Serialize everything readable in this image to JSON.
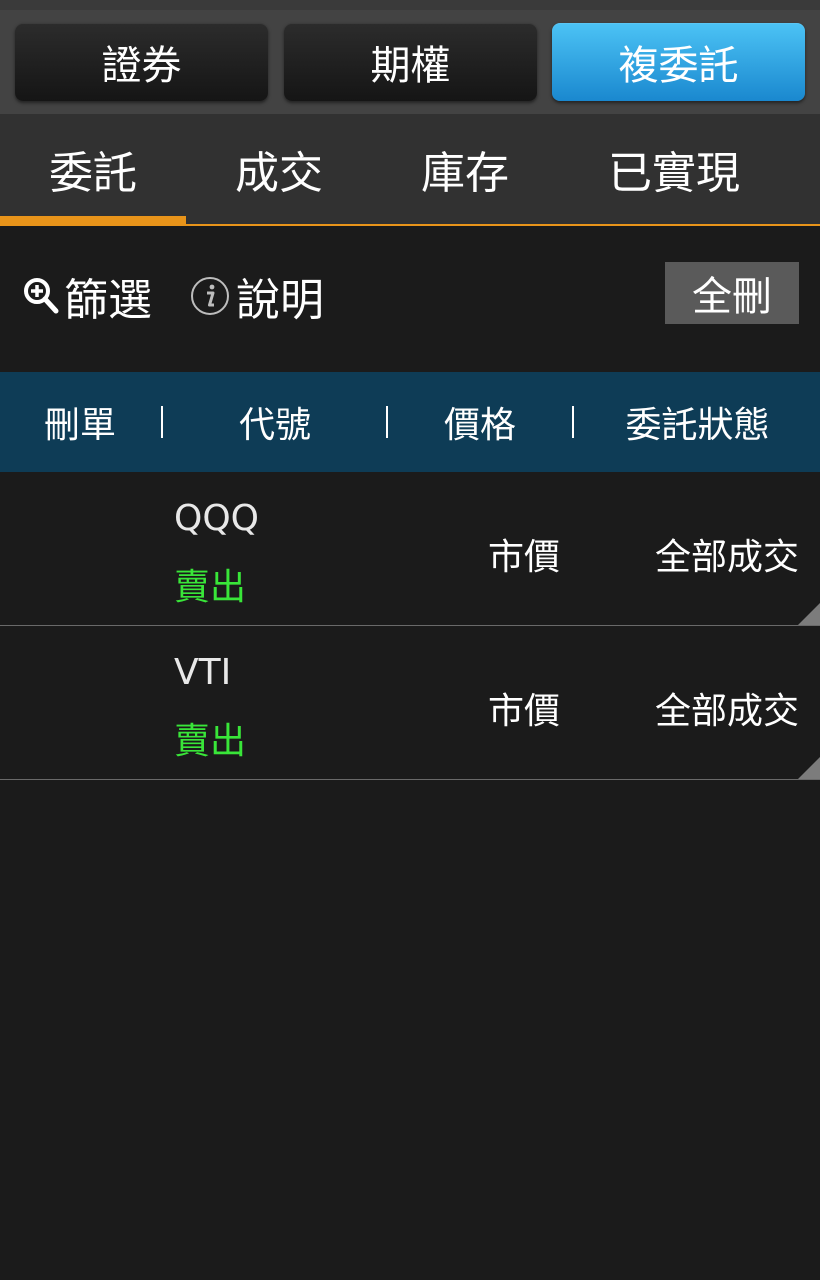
{
  "segments": [
    "證券",
    "期權",
    "複委託"
  ],
  "tabs": [
    "委託",
    "成交",
    "庫存",
    "已實現"
  ],
  "toolbar": {
    "filter_label": "篩選",
    "help_label": "說明",
    "delete_all_label": "全刪"
  },
  "table": {
    "headers": [
      "刪單",
      "代號",
      "價格",
      "委託狀態"
    ],
    "rows": [
      {
        "symbol": "QQQ",
        "side": "賣出",
        "price": "市價",
        "status": "全部成交"
      },
      {
        "symbol": "VTI",
        "side": "賣出",
        "price": "市價",
        "status": "全部成交"
      }
    ]
  },
  "colors": {
    "accent": "#e8941a",
    "active_segment": "#2a9fe0",
    "header_bg": "#0e3c56",
    "sell": "#39e639"
  }
}
